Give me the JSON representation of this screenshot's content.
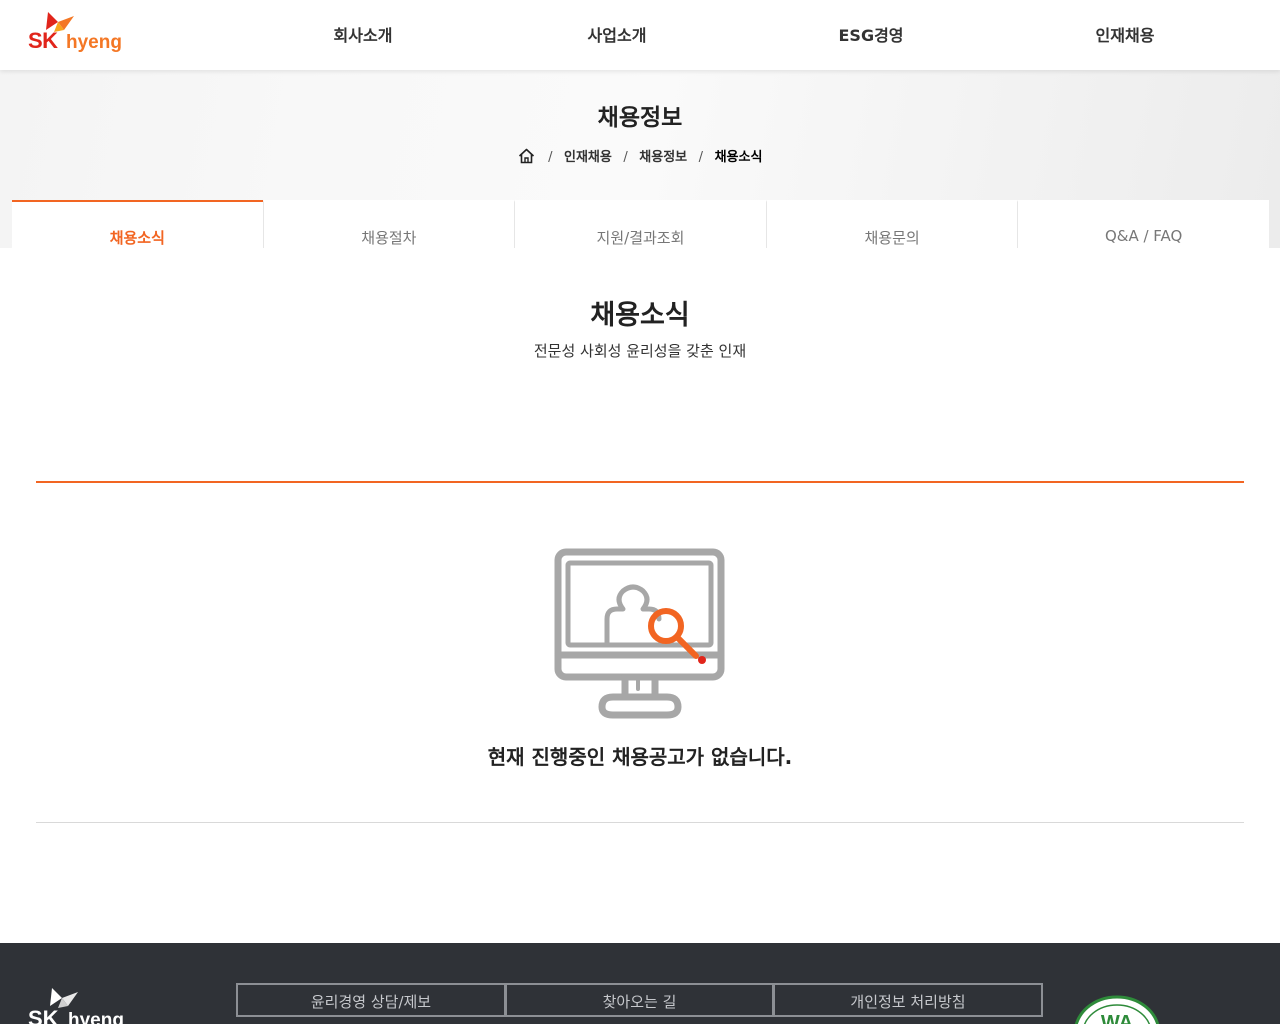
{
  "header": {
    "logo_sk": "SK",
    "logo_hyeng": "hyeng",
    "nav": [
      "회사소개",
      "사업소개",
      "ESG경영",
      "인재채용"
    ]
  },
  "subvisual": {
    "title": "채용정보",
    "breadcrumb": [
      "인재채용",
      "채용정보",
      "채용소식"
    ],
    "separator": "/"
  },
  "tabs": [
    {
      "label": "채용소식",
      "active": true
    },
    {
      "label": "채용절차",
      "active": false
    },
    {
      "label": "지원/결과조회",
      "active": false
    },
    {
      "label": "채용문의",
      "active": false
    },
    {
      "label": "Q&A / FAQ",
      "active": false
    }
  ],
  "content": {
    "title": "채용소식",
    "subtitle": "전문성 사회성 윤리성을 갖춘 인재",
    "empty_message": "현재 진행중인 채용공고가 없습니다."
  },
  "footer": {
    "logo_sk": "SK",
    "logo_hyeng": "hyeng",
    "links": [
      "윤리경영 상담/제보",
      "찾아오는 길",
      "개인정보 처리방침"
    ],
    "badge_text": "WA"
  },
  "colors": {
    "accent": "#f26522",
    "logo_red": "#e1251b",
    "logo_orange": "#f47725",
    "footer_bg": "#2f3237"
  },
  "icons": [
    "sk-wings-logo",
    "home-icon",
    "monitor-search-icon",
    "wa-certification-mark"
  ]
}
